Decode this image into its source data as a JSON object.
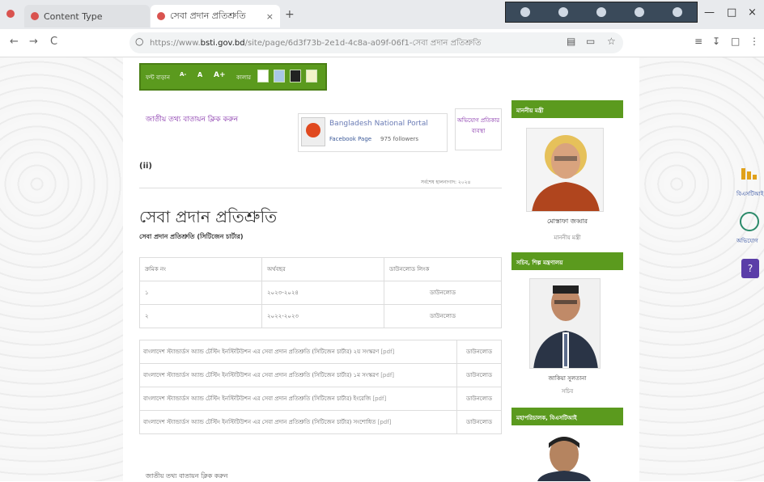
{
  "browser": {
    "tab1_title": "Content Type",
    "tab2_title": "সেবা প্রদান প্রতিশ্রুতি",
    "new_tab": "+",
    "url_prefix": "https://www.",
    "url_host": "bsti.gov.bd",
    "url_rest": "/site/page/6d3f73b-2e1d-4c8a-a09f-06f1-সেবা প্রদান প্রতিশ্রুতি",
    "nav_back": "←",
    "nav_forward": "→",
    "nav_reload": "C",
    "window_min": "—",
    "window_max": "□",
    "window_close": "×"
  },
  "toolbar": {
    "font_label": "ফন্ট বাড়ান",
    "size_small": "A-",
    "size_normal": "A",
    "size_large": "A+",
    "color_label": "কালার"
  },
  "top": {
    "national_link": "জাতীয় তথ্য বাতায়ন ক্লিক করুন",
    "portal_title": "Bangladesh National Portal",
    "portal_fb": "Facebook Page",
    "portal_likes": "975 followers",
    "map_button": "অভিযোগ প্রতিকার ব্যবস্থা",
    "small_tag": "(ii)",
    "date_line": "সর্বশেষ হালনাগাদ: ২০২৪"
  },
  "main": {
    "title": "সেবা প্রদান প্রতিশ্রুতি",
    "subtitle": "সেবা প্রদান প্রতিশ্রুতি (সিটিজেন চার্টার)",
    "table1_header": [
      "ক্রমিক নং",
      "অর্থবছর",
      "ডাউনলোড লিংক"
    ],
    "table1_rows": [
      [
        "১",
        "২০২৩-২০২৪",
        "ডাউনলোড"
      ],
      [
        "২",
        "২০২২-২০২৩",
        "ডাউনলোড"
      ]
    ],
    "table2_rows": [
      {
        "text": "বাংলাদেশ স্ট্যান্ডার্ডস অ্যান্ড টেস্টিং ইনস্টিটিউশন এর সেবা প্রদান প্রতিশ্রুতি (সিটিজেন চার্টার) ২য় সংস্করণ",
        "file": "[pdf]",
        "link": "ডাউনলোড"
      },
      {
        "text": "বাংলাদেশ স্ট্যান্ডার্ডস অ্যান্ড টেস্টিং ইনস্টিটিউশন এর সেবা প্রদান প্রতিশ্রুতি (সিটিজেন চার্টার) ১ম সংস্করণ",
        "file": "[pdf]",
        "link": "ডাউনলোড"
      },
      {
        "text": "বাংলাদেশ স্ট্যান্ডার্ডস অ্যান্ড টেস্টিং ইনস্টিটিউশন এর সেবা প্রদান প্রতিশ্রুতি (সিটিজেন চার্টার) ইংরেজি",
        "file": "[pdf]",
        "link": "ডাউনলোড"
      },
      {
        "text": "বাংলাদেশ স্ট্যান্ডার্ডস অ্যান্ড টেস্টিং ইনস্টিটিউশন এর সেবা প্রদান প্রতিশ্রুতি (সিটিজেন চার্টার) সংশোধিত",
        "file": "[pdf]",
        "link": "ডাউনলোড"
      }
    ],
    "footer_link": "জাতীয় তথ্য বাতায়ন ক্লিক করুন"
  },
  "sidebar": {
    "section1": "মাননীয় মন্ত্রী",
    "person1_name": "মোস্তাফা জব্বার",
    "person1_role": "মাননীয় মন্ত্রী",
    "section2": "সচিব, শিল্প মন্ত্রণালয়",
    "person2_name": "জাকিয়া সুলতানা",
    "person2_role": "সচিব",
    "section3": "মহাপরিচালক, বিএসটিআই"
  },
  "right_edge": {
    "label1": "বিএসটিআই",
    "label2": "অভিযোগ"
  },
  "colors": {
    "green": "#5b9a1e",
    "purple_link": "#7a1fa2"
  }
}
